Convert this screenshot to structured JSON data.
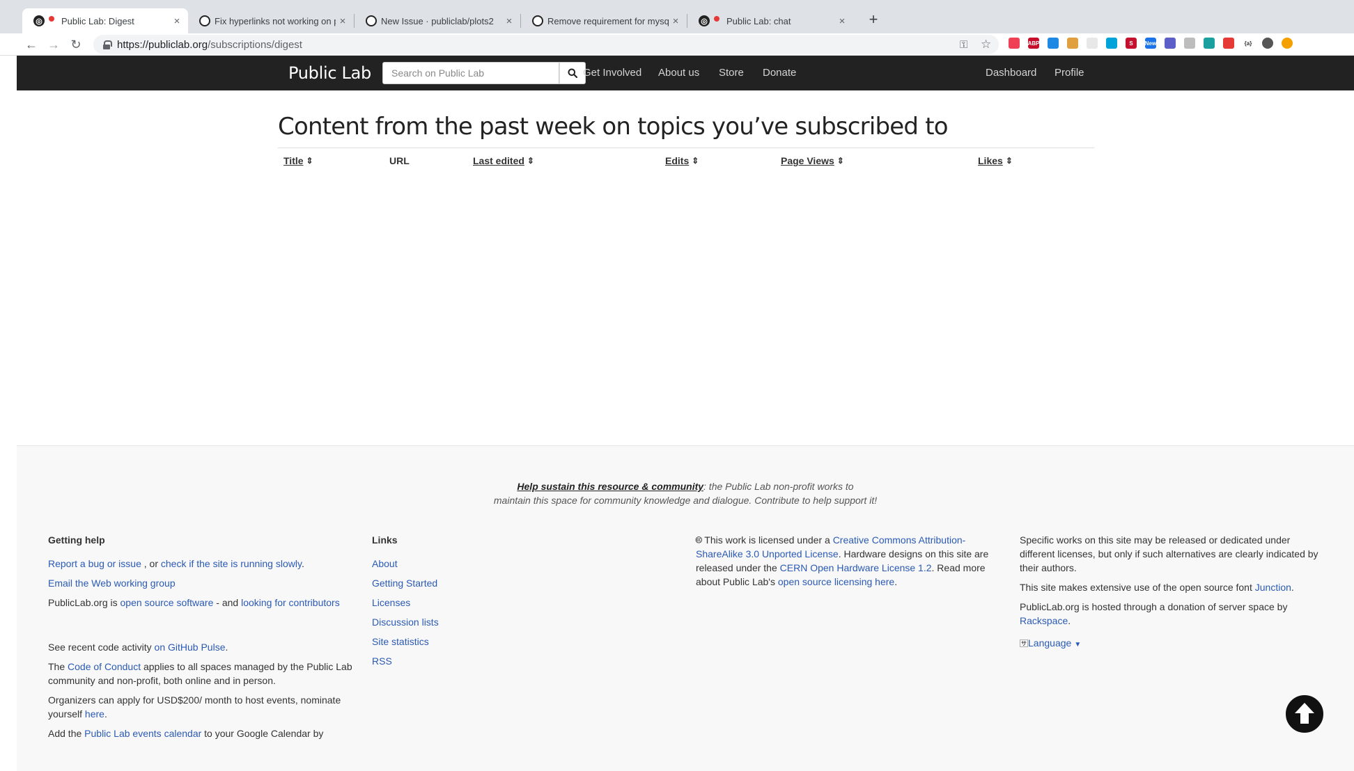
{
  "browser": {
    "tabs": [
      {
        "title": "Public Lab: Digest",
        "active": true
      },
      {
        "title": "Fix hyperlinks not working on p",
        "active": false
      },
      {
        "title": "New Issue · publiclab/plots2",
        "active": false
      },
      {
        "title": "Remove requirement for mysql",
        "active": false
      },
      {
        "title": "Public Lab: chat",
        "active": false
      }
    ],
    "close_glyph": "×",
    "new_tab_glyph": "+",
    "url_host": "https://publiclab.org",
    "url_path": "/subscriptions/digest",
    "extensions": [
      {
        "name": "pocket",
        "color": "#ef4056"
      },
      {
        "name": "adblock-plus",
        "color": "#c70d2c",
        "label": "ABP"
      },
      {
        "name": "extension-blue",
        "color": "#1e88e5"
      },
      {
        "name": "extension-box",
        "color": "#e0a040"
      },
      {
        "name": "extension-blank",
        "color": "#e8e8e8"
      },
      {
        "name": "extension-cyan",
        "color": "#00a3d9"
      },
      {
        "name": "extension-s",
        "color": "#c4122e",
        "label": "S"
      },
      {
        "name": "extension-new",
        "color": "#1a73e8",
        "label": "New"
      },
      {
        "name": "extension-tool",
        "color": "#5b5fc7"
      },
      {
        "name": "extension-gray",
        "color": "#bdbdbd"
      },
      {
        "name": "extension-teal",
        "color": "#1ba0a0"
      },
      {
        "name": "extension-red",
        "color": "#e53935"
      },
      {
        "name": "extension-braces",
        "color": "#ffffff",
        "label": "{a}"
      },
      {
        "name": "profile-avatar",
        "color": "#555555"
      },
      {
        "name": "extension-orange",
        "color": "#f4a000"
      }
    ]
  },
  "nav": {
    "brand": "Public Lab",
    "search_placeholder": "Search on Public Lab",
    "links": [
      "Get Involved",
      "About us",
      "Store",
      "Donate"
    ],
    "right_links": [
      "Dashboard",
      "Profile"
    ]
  },
  "main": {
    "title": "Content from the past week on topics you’ve subscribed to",
    "columns": [
      {
        "label": "Title",
        "sortable": true
      },
      {
        "label": "URL",
        "sortable": false
      },
      {
        "label": "Last edited",
        "sortable": true
      },
      {
        "label": "Edits",
        "sortable": true
      },
      {
        "label": "Page Views",
        "sortable": true
      },
      {
        "label": "Likes",
        "sortable": true
      }
    ],
    "rows": []
  },
  "footer": {
    "sustain_link": "Help sustain this resource & community",
    "sustain_text_1": ": the Public Lab non-profit works to",
    "sustain_text_2": "maintain this space for community knowledge and dialogue. Contribute to help support it!",
    "getting_help": {
      "heading": "Getting help",
      "report_bug": "Report a bug or issue",
      "or": " , or ",
      "check_site": "check if the site is running slowly",
      "period": ".",
      "email_group": "Email the Web working group",
      "oss_prefix": "PublicLab.org is ",
      "oss_link": "open source software",
      "oss_mid": " - and ",
      "contributors_link": "looking for contributors",
      "code_activity_prefix": "See recent code activity ",
      "github_pulse": "on GitHub Pulse",
      "coc_prefix": "The ",
      "coc_link": "Code of Conduct",
      "coc_text": " applies to all spaces managed by the Public Lab community and non-profit, both online and in person.",
      "organizers_text": "Organizers can apply for USD$200/ month to host events, nominate yourself ",
      "here": "here",
      "calendar_prefix": "Add the ",
      "calendar_link": "Public Lab events calendar",
      "calendar_suffix": " to your Google Calendar by"
    },
    "links": {
      "heading": "Links",
      "items": [
        "About",
        "Getting Started",
        "Licenses",
        "Discussion lists",
        "Site statistics",
        "RSS"
      ]
    },
    "license": {
      "cc_icon": "🅭",
      "prefix": " This work is licensed under a ",
      "cc_link": "Creative Commons Attribution-ShareAlike 3.0 Unported License",
      "mid": ". Hardware designs on this site are released under the ",
      "cern_link": "CERN Open Hardware License 1.2",
      "mid2": ". Read more about Public Lab's ",
      "oss_licensing": "open source licensing here",
      "end": "."
    },
    "specific": {
      "text": "Specific works on this site may be released or dedicated under different licenses, but only if such alternatives are clearly indicated by their authors.",
      "font_prefix": "This site makes extensive use of the open source font ",
      "junction": "Junction",
      "hosted_prefix": "PublicLab.org is hosted through a donation of server space by ",
      "rackspace": "Rackspace",
      "language": "Language"
    }
  }
}
